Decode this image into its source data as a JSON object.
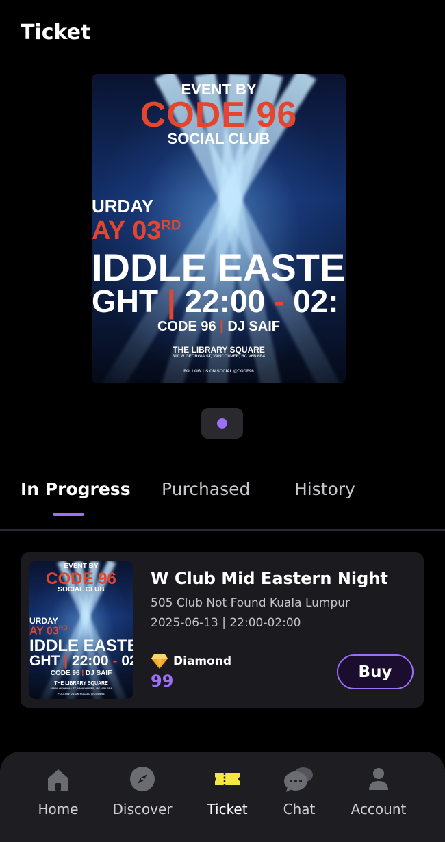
{
  "header": {
    "title": "Ticket"
  },
  "poster": {
    "event_by": "EVENT BY",
    "brand": "CODE 96",
    "social_club": "SOCIAL CLUB",
    "day": "URDAY",
    "date": "AY 03",
    "date_suffix": "RD",
    "headline1": "IDDLE EASTER",
    "headline2_a": "GHT",
    "headline2_sep": "|",
    "headline2_b": "22:00",
    "headline2_dash": "-",
    "headline2_c": "02:",
    "dj_a": "CODE 96",
    "dj_sep": "|",
    "dj_b": "DJ SAIF",
    "venue": "THE LIBRARY SQUARE",
    "address": "300 W GEORGIA ST, VANCOUVER, BC V6B 6B4",
    "follow": "FOLLOW US ON SOCIAL @CODE96"
  },
  "tabs": [
    {
      "label": "In Progress",
      "active": true
    },
    {
      "label": "Purchased",
      "active": false
    },
    {
      "label": "History",
      "active": false
    }
  ],
  "card": {
    "title": "W Club Mid Eastern Night",
    "venue": "505 Club Not Found Kuala Lumpur",
    "datetime": "2025-06-13 | 22:00-02:00",
    "tier": "Diamond",
    "price": "99",
    "buy_label": "Buy"
  },
  "nav": [
    {
      "label": "Home",
      "icon": "home-icon",
      "active": false
    },
    {
      "label": "Discover",
      "icon": "compass-icon",
      "active": false
    },
    {
      "label": "Ticket",
      "icon": "ticket-icon",
      "active": true
    },
    {
      "label": "Chat",
      "icon": "chat-icon",
      "active": false
    },
    {
      "label": "Account",
      "icon": "person-icon",
      "active": false
    }
  ],
  "colors": {
    "accent": "#9b6ff6",
    "ticket_icon": "#f5e642",
    "brand_red": "#e4452f",
    "card_bg": "#1b1b1f"
  }
}
